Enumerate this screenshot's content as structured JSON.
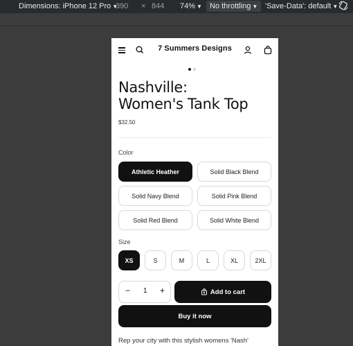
{
  "devtools": {
    "device": "Dimensions: iPhone 12 Pro",
    "width": "390",
    "times": "×",
    "height": "844",
    "zoom": "74%",
    "throttling": "No throttling",
    "save_data": "'Save-Data': default"
  },
  "header": {
    "brand": "7 Summers Designs"
  },
  "product": {
    "title_line1": "Nashville:",
    "title_line2": "Women's Tank Top",
    "price": "$32.50"
  },
  "color": {
    "label": "Color",
    "selected": "Athletic Heather",
    "options": [
      "Athletic Heather",
      "Solid Black Blend",
      "Solid Navy Blend",
      "Solid Pink Blend",
      "Solid Red Blend",
      "Solid White Blend"
    ]
  },
  "size": {
    "label": "Size",
    "selected": "XS",
    "options": [
      "XS",
      "S",
      "M",
      "L",
      "XL",
      "2XL"
    ]
  },
  "quantity": {
    "minus": "−",
    "value": "1",
    "plus": "+"
  },
  "actions": {
    "add_to_cart": "Add to cart",
    "buy_now": "Buy it now"
  },
  "description": "Rep your city with this stylish womens 'Nash'",
  "icons": [
    "menu-icon",
    "search-icon",
    "user-icon",
    "bag-icon",
    "cart-icon",
    "rotate-icon",
    "caret-icon"
  ]
}
